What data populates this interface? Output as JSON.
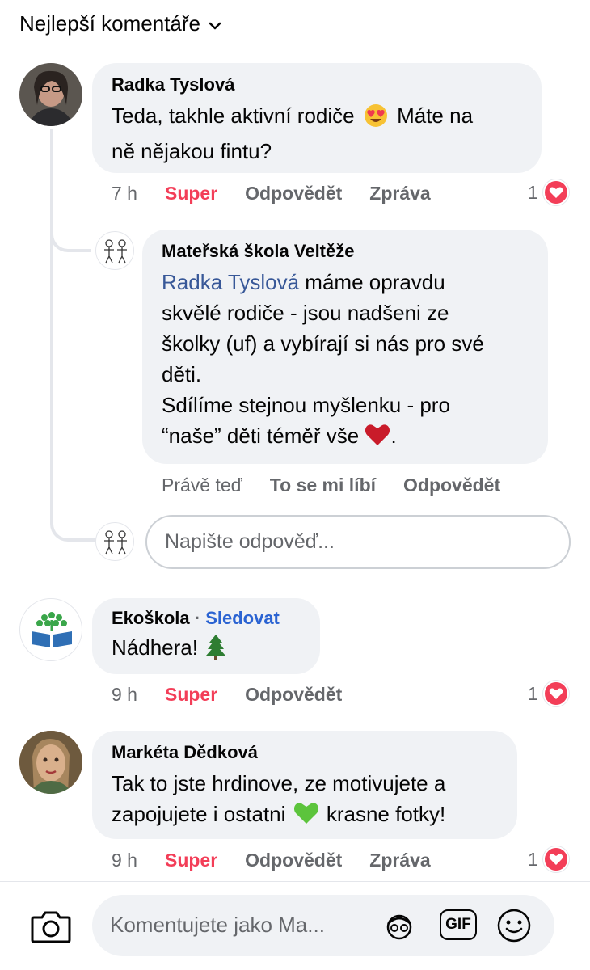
{
  "header": {
    "sort_label": "Nejlepší komentáře"
  },
  "comments": [
    {
      "author": "Radka Tyslová",
      "text_a": "Teda, takhle aktivní rodiče",
      "emoji": "heart-eyes-emoji",
      "text_b": "Máte na",
      "text_c": "ně nějakou fintu?",
      "time": "7 h",
      "reaction_label": "Super",
      "reply_label": "Odpovědět",
      "message_label": "Zpráva",
      "reaction_count": "1"
    },
    {
      "author": "Ekoškola",
      "follow_sep": "·",
      "follow_label": "Sledovat",
      "text": "Nádhera!",
      "emoji": "tree-emoji",
      "time": "9 h",
      "reaction_label": "Super",
      "reply_label": "Odpovědět",
      "reaction_count": "1"
    },
    {
      "author": "Markéta Dědková",
      "text_a": "Tak to jste hrdinove, ze motivujete a",
      "text_b": "zapojujete i ostatni",
      "emoji": "green-heart-emoji",
      "text_c": "krasne fotky!",
      "time": "9 h",
      "reaction_label": "Super",
      "reply_label": "Odpovědět",
      "message_label": "Zpráva",
      "reaction_count": "1"
    }
  ],
  "reply": {
    "author": "Mateřská škola Veltěže",
    "mention": "Radka Tyslová",
    "line1_rest": "máme opravdu",
    "line2": "skvělé rodiče - jsou nadšeni ze",
    "line3": "školky (uf) a vybírají si nás pro své",
    "line4": "děti.",
    "line5": "Sdílíme stejnou myšlenku - pro",
    "line6_a": "“naše” děti téměř vše",
    "emoji": "red-heart-emoji",
    "line6_b": ".",
    "time": "Právě teď",
    "like_label": "To se mi líbí",
    "reply_label": "Odpovědět"
  },
  "reply_input": {
    "placeholder": "Napište odpověď..."
  },
  "composer": {
    "placeholder": "Komentujete jako Ma...",
    "gif_label": "GIF"
  },
  "colors": {
    "accent_red": "#f33e58",
    "mention_blue": "#385898",
    "bubble_bg": "#f0f2f5",
    "muted": "#65676b"
  }
}
